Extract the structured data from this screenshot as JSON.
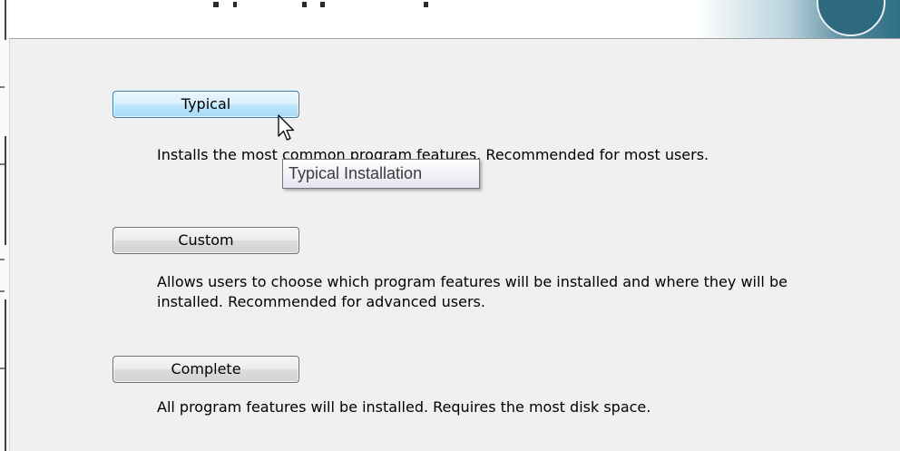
{
  "options": [
    {
      "label": "Typical",
      "description": "Installs the most common program features. Recommended for most users.",
      "state": "hover"
    },
    {
      "label": "Custom",
      "description": "Allows users to choose which program features will be installed and where they will be installed. Recommended for advanced users.",
      "state": "normal"
    },
    {
      "label": "Complete",
      "description": "All program features will be installed. Requires the most disk space.",
      "state": "normal"
    }
  ],
  "tooltip": {
    "text": "Typical Installation"
  },
  "icons": {
    "cursor": "arrow-pointer-icon",
    "logo": "installer-logo-icon"
  },
  "colors": {
    "background": "#f0f0f0",
    "header": "#ffffff",
    "hover_button_border": "#3c7fb1",
    "button_border": "#707070",
    "logo_teal": "#2d6a80"
  }
}
